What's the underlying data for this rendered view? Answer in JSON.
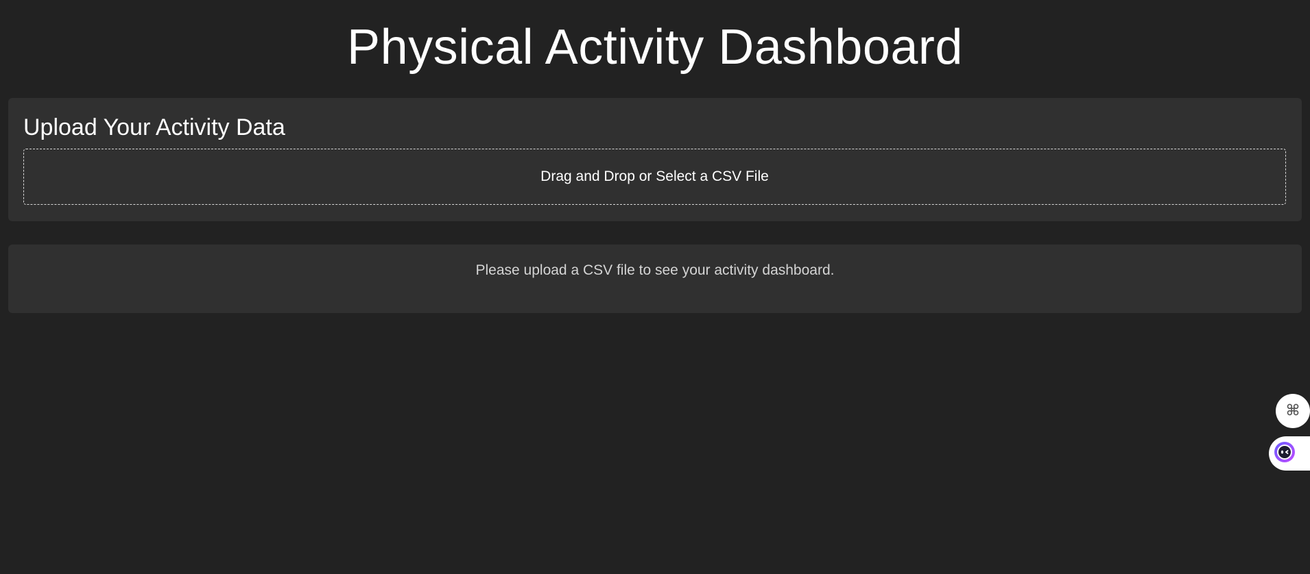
{
  "header": {
    "title": "Physical Activity Dashboard"
  },
  "upload": {
    "heading": "Upload Your Activity Data",
    "dropzone_label": "Drag and Drop or Select a CSV File"
  },
  "status": {
    "message": "Please upload a CSV file to see your activity dashboard."
  },
  "floating_buttons": {
    "apps_icon": "command-key-icon",
    "assistant_icon": "assistant-face-icon"
  },
  "colors": {
    "background": "#222222",
    "card": "#303030",
    "text": "#ffffff",
    "muted_text": "#d4d4d4",
    "assistant_gradient_start": "#6a5cff",
    "assistant_gradient_end": "#c04bff"
  }
}
